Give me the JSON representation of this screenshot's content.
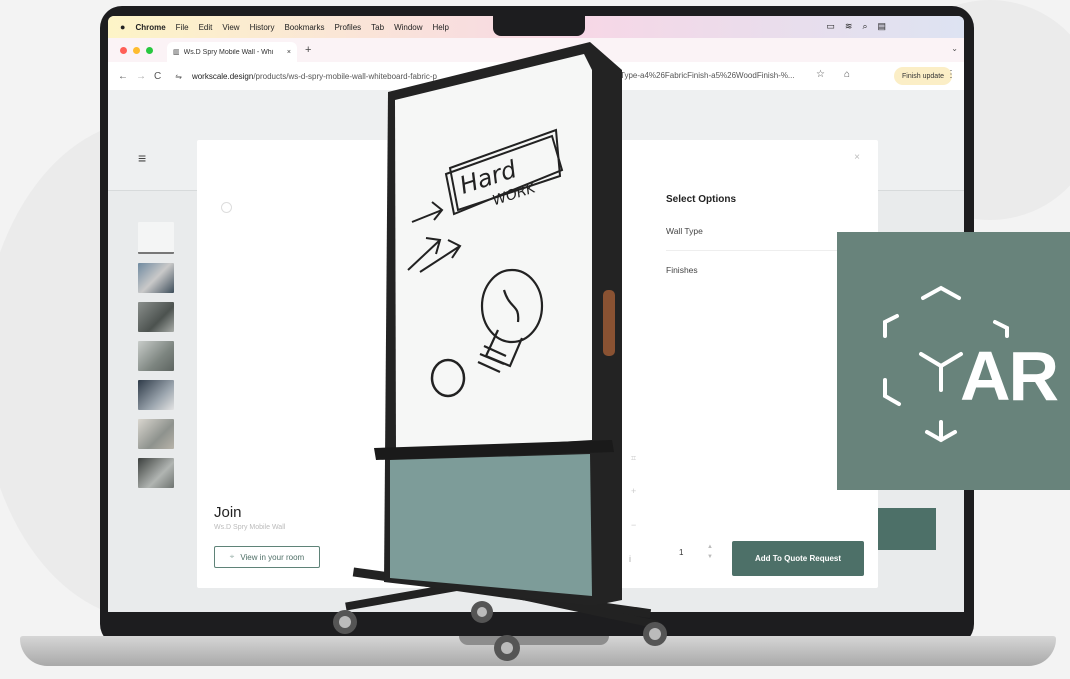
{
  "colors": {
    "accent": "#4d7068",
    "ar_panel": "#68837b",
    "bezel": "#1d1d1f",
    "finish_chip": "#fbeec6"
  },
  "menubar": {
    "apple_icon": "apple-logo-icon",
    "app": "Chrome",
    "items": [
      "File",
      "Edit",
      "View",
      "History",
      "Bookmarks",
      "Profiles",
      "Tab",
      "Window",
      "Help"
    ],
    "status_icons": [
      "battery-icon",
      "wifi-icon",
      "search-icon",
      "control-center-icon"
    ]
  },
  "tabbar": {
    "tab_title": "Ws.D Spry Mobile Wall - Whi",
    "close": "×",
    "new_tab": "+",
    "chevron": "⌄"
  },
  "toolbar": {
    "back": "←",
    "forward": "→",
    "reload": "C",
    "site_info": "⇋",
    "url_domain": "workscale.design",
    "url_path": "/products/ws-d-spry-mobile-wall-whiteboard-fabric-p",
    "url_tail": "Type-a4%26FabricFinish-a5%26WoodFinish-%...",
    "star": "☆",
    "extensions": "⌂",
    "finish_update": "Finish update",
    "menu": "⋮"
  },
  "site": {
    "menu_icon": "≡",
    "thumbnails": 7
  },
  "modal": {
    "close": "×",
    "product_title": "Join",
    "product_subtitle": "Ws.D Spry Mobile Wall",
    "view_in_room": "View in your room",
    "options_title": "Select Options",
    "option_rows": [
      "Wall Type",
      "Finishes"
    ],
    "side_controls": [
      "⌗",
      "+",
      "−"
    ],
    "quantity": "1",
    "quantity_up": "▲",
    "quantity_down": "▼",
    "info": "i",
    "add_to_quote": "Add To Quote Request"
  },
  "whiteboard": {
    "doodle_word_1": "Hard",
    "doodle_word_2": "WORK"
  },
  "ar_panel": {
    "label": "AR",
    "icon": "ar-cube-icon"
  }
}
